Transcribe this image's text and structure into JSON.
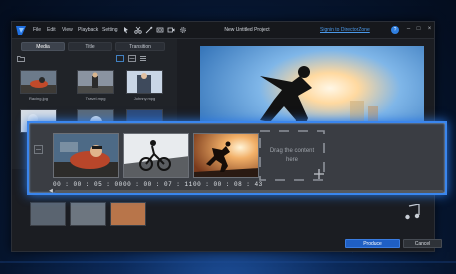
{
  "menu": {
    "items": [
      "File",
      "Edit",
      "View",
      "Playback",
      "Setting"
    ]
  },
  "project": {
    "title": "New Untitled Project"
  },
  "account": {
    "signin": "Signin to DirectorZone",
    "help": "?"
  },
  "library": {
    "tabs": [
      "Media",
      "Title",
      "Transition"
    ],
    "clips": [
      {
        "name": "Racing.jpg"
      },
      {
        "name": "Travel.mpg"
      },
      {
        "name": "Johnny.mpg"
      }
    ]
  },
  "storyboard": {
    "clips": [
      {
        "time": "00 : 00 : 05 : 00"
      },
      {
        "time": "00 : 00 : 07 : 11"
      },
      {
        "time": "00 : 00 : 08 : 43"
      }
    ],
    "drop_hint": "Drag the content here"
  },
  "actions": {
    "produce": "Produce",
    "cancel": "Cancel"
  },
  "colors": {
    "accent": "#3a86ee",
    "window_bg": "#1b1d22",
    "produce_bg": "#1f5fc4"
  }
}
